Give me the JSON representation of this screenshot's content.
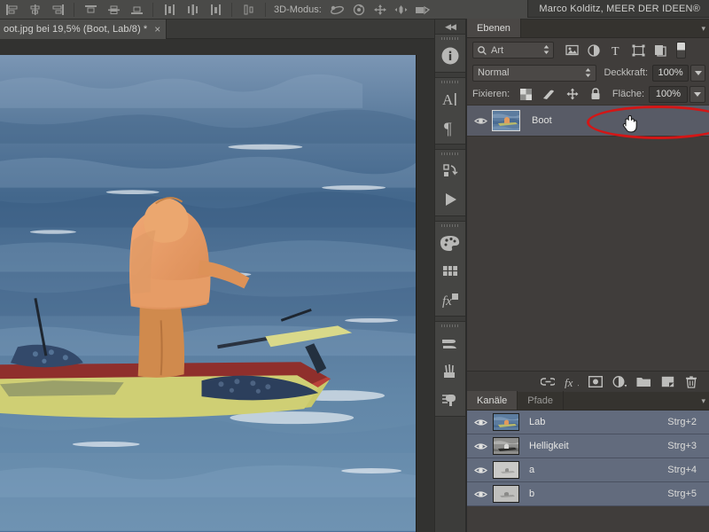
{
  "options_bar": {
    "align_icons": [
      "align-left-edges-icon",
      "align-horizontal-centers-icon",
      "align-right-edges-icon",
      "align-top-edges-icon",
      "align-vertical-centers-icon",
      "align-bottom-edges-icon",
      "distribute-left-edges-icon",
      "distribute-horizontal-centers-icon",
      "distribute-right-edges-icon",
      "distribute-vertical-icon"
    ],
    "mode3d_label": "3D-Modus:",
    "mode3d_icons": [
      "rotate-3d-icon",
      "roll-3d-icon",
      "pan-3d-icon",
      "slide-3d-icon",
      "scale-3d-icon"
    ]
  },
  "watermark": {
    "text": "Marco Kolditz, MEER DER IDEEN®"
  },
  "document_tab": {
    "title": "oot.jpg bei 19,5% (Boot, Lab/8) *",
    "close_label": "×"
  },
  "icon_dock": {
    "collapse_label": "◀◀",
    "groups": [
      {
        "items": [
          {
            "name": "info-icon"
          }
        ]
      },
      {
        "items": [
          {
            "name": "character-icon"
          },
          {
            "name": "paragraph-icon"
          }
        ]
      },
      {
        "items": [
          {
            "name": "history-icon"
          },
          {
            "name": "actions-play-icon"
          }
        ]
      },
      {
        "items": [
          {
            "name": "color-palette-icon"
          },
          {
            "name": "swatches-icon"
          },
          {
            "name": "layer-styles-fx-icon"
          }
        ]
      },
      {
        "items": [
          {
            "name": "brush-icon"
          },
          {
            "name": "brush-presets-icon"
          },
          {
            "name": "tool-presets-icon"
          }
        ]
      }
    ]
  },
  "layers_panel": {
    "tabs": [
      {
        "label": "Ebenen",
        "active": true
      }
    ],
    "menu_label": "▾",
    "filter": {
      "search_icon": "search-icon",
      "value": "Art",
      "icons": [
        "filter-pixel-layers-icon",
        "filter-adjustment-layers-icon",
        "filter-type-layers-icon",
        "filter-shape-layers-icon",
        "filter-smart-object-icon"
      ],
      "toggle_name": "filter-enable-toggle"
    },
    "blend": {
      "mode": "Normal",
      "opacity_label": "Deckkraft:",
      "opacity_value": "100%"
    },
    "lock": {
      "label": "Fixieren:",
      "icons": [
        "lock-transparent-pixels-icon",
        "lock-image-pixels-icon",
        "lock-position-icon",
        "lock-all-icon"
      ],
      "fill_label": "Fläche:",
      "fill_value": "100%"
    },
    "layers": [
      {
        "name": "Boot",
        "visible": true,
        "selected": true,
        "visibility_icon": "eye-icon"
      }
    ],
    "annotation": {
      "shape": "red-ellipse-highlight",
      "color": "#d31616"
    },
    "cursor": {
      "name": "hand-cursor-icon"
    },
    "footer_icons": [
      "link-layers-icon",
      "layer-style-fx-icon",
      "add-layer-mask-icon",
      "new-adjustment-layer-icon",
      "new-group-icon",
      "new-layer-icon",
      "delete-layer-icon"
    ],
    "footer_fx_label": "fx"
  },
  "channels_panel": {
    "tabs": [
      {
        "label": "Kanäle",
        "active": true
      },
      {
        "label": "Pfade",
        "active": false
      }
    ],
    "menu_label": "▾",
    "channels": [
      {
        "name": "Lab",
        "shortcut": "Strg+2",
        "visible": true,
        "visibility_icon": "eye-icon",
        "thumb": "composite"
      },
      {
        "name": "Helligkeit",
        "shortcut": "Strg+3",
        "visible": true,
        "visibility_icon": "eye-icon",
        "thumb": "lightness"
      },
      {
        "name": "a",
        "shortcut": "Strg+4",
        "visible": true,
        "visibility_icon": "eye-icon",
        "thumb": "a-channel"
      },
      {
        "name": "b",
        "shortcut": "Strg+5",
        "visible": true,
        "visibility_icon": "eye-icon",
        "thumb": "b-channel"
      }
    ]
  },
  "canvas": {
    "image_alt": "fisherman-in-orange-rain-gear-on-boat-at-sea"
  },
  "colors": {
    "panel_bg": "#403d3b",
    "panel_tab_bg": "#35332f",
    "layer_selected": "#585b66",
    "channel_row": "#626b7d",
    "annotation_red": "#d31616",
    "text": "#dcdcda"
  }
}
